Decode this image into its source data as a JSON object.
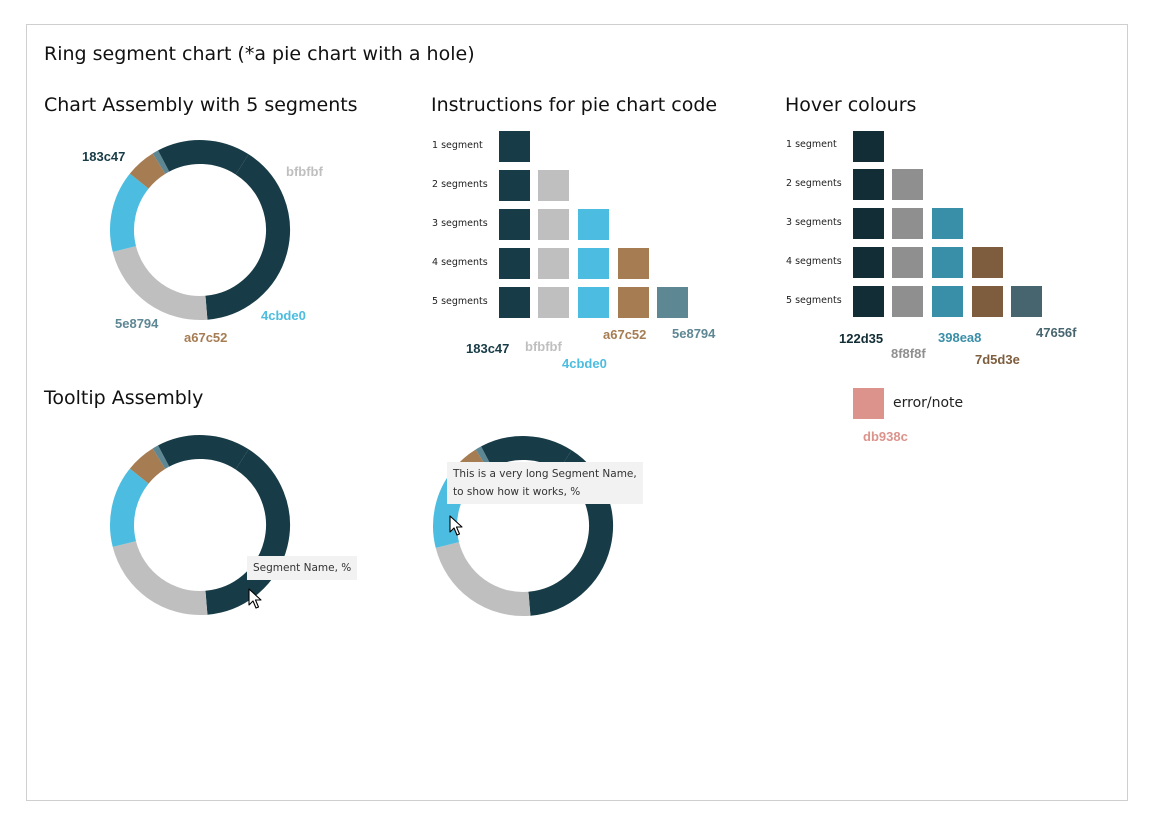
{
  "page_title": "Ring segment chart (*a pie chart with a hole)",
  "sections": {
    "assembly": "Chart Assembly with 5 segments",
    "instructions": "Instructions for pie chart code",
    "hover": "Hover colours",
    "tooltip": "Tooltip Assembly"
  },
  "palette": {
    "segments": [
      "#183c47",
      "#bfbfbf",
      "#4cbde0",
      "#a67c52",
      "#5e8794"
    ],
    "hover": [
      "#122d35",
      "#8f8f8f",
      "#398ea8",
      "#7d5d3e",
      "#47656f"
    ],
    "error": "#db938c"
  },
  "assembly_labels": [
    "183c47",
    "bfbfbf",
    "4cbde0",
    "a67c52",
    "5e8794"
  ],
  "row_labels": [
    "1 segment",
    "2 segments",
    "3 segments",
    "4 segments",
    "5 segments"
  ],
  "code_labels": [
    "183c47",
    "bfbfbf",
    "4cbde0",
    "a67c52",
    "5e8794"
  ],
  "hover_labels": [
    "122d35",
    "8f8f8f",
    "398ea8",
    "7d5d3e",
    "47656f"
  ],
  "error": {
    "label": "error/note",
    "code": "db938c"
  },
  "tooltips": {
    "short": "Segment Name, %",
    "long_line1": "This is a very long Segment Name,",
    "long_line2": "to show how it works, %"
  },
  "ring": {
    "segment_percent": [
      39.6,
      22.4,
      14.7,
      5.4,
      1.1,
      16.8
    ],
    "segment_colors": [
      "#183c47",
      "#bfbfbf",
      "#4cbde0",
      "#a67c52",
      "#5e8794",
      "#183c47"
    ]
  }
}
